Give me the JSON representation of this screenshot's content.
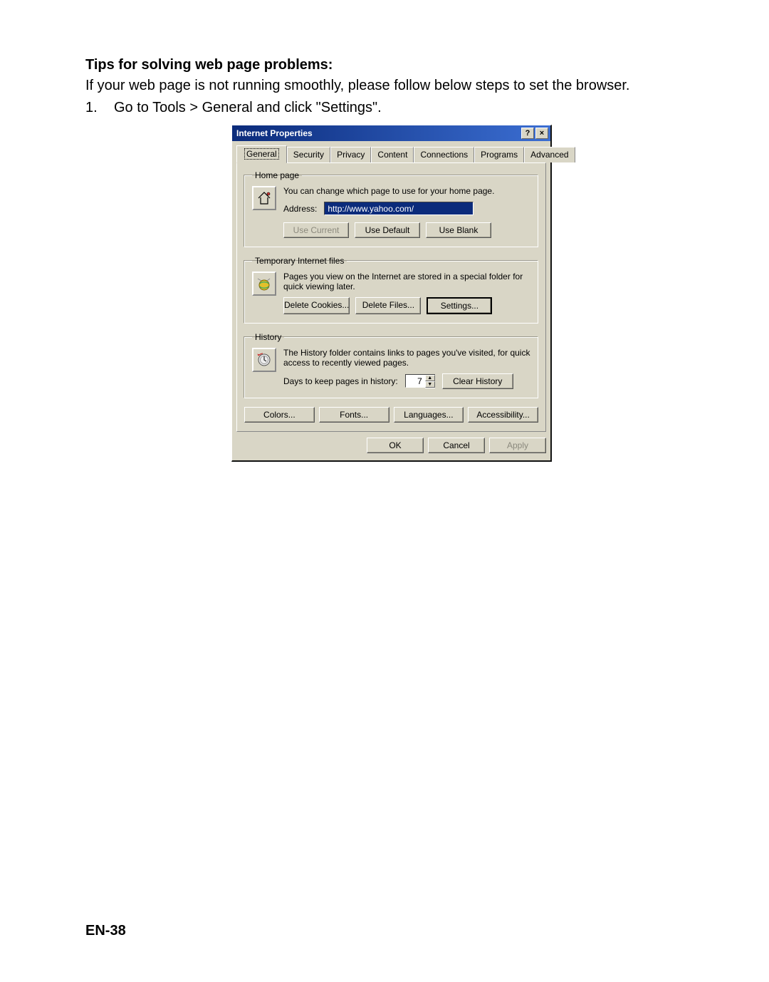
{
  "doc": {
    "tips_heading": "Tips for solving web page problems:",
    "intro_text": "If your web page is not running smoothly, please follow below steps to set the browser.",
    "step1_num": "1.",
    "step1_text": "Go to Tools > General and click \"Settings\".",
    "page_number": "EN-38"
  },
  "dialog": {
    "title": "Internet Properties",
    "titlebar_help": "?",
    "titlebar_close": "×",
    "tabs": [
      "General",
      "Security",
      "Privacy",
      "Content",
      "Connections",
      "Programs",
      "Advanced"
    ],
    "home_page": {
      "legend": "Home page",
      "desc": "You can change which page to use for your home page.",
      "address_label": "Address:",
      "address_value": "http://www.yahoo.com/",
      "buttons": {
        "use_current": "Use Current",
        "use_default": "Use Default",
        "use_blank": "Use Blank"
      }
    },
    "temp_files": {
      "legend": "Temporary Internet files",
      "desc": "Pages you view on the Internet are stored in a special folder for quick viewing later.",
      "buttons": {
        "delete_cookies": "Delete Cookies...",
        "delete_files": "Delete Files...",
        "settings": "Settings..."
      }
    },
    "history": {
      "legend": "History",
      "desc": "The History folder contains links to pages you've visited, for quick access to recently viewed pages.",
      "days_label": "Days to keep pages in history:",
      "days_value": "7",
      "clear_history": "Clear History"
    },
    "bottom_buttons": {
      "colors": "Colors...",
      "fonts": "Fonts...",
      "languages": "Languages...",
      "accessibility": "Accessibility..."
    },
    "footer": {
      "ok": "OK",
      "cancel": "Cancel",
      "apply": "Apply"
    }
  }
}
